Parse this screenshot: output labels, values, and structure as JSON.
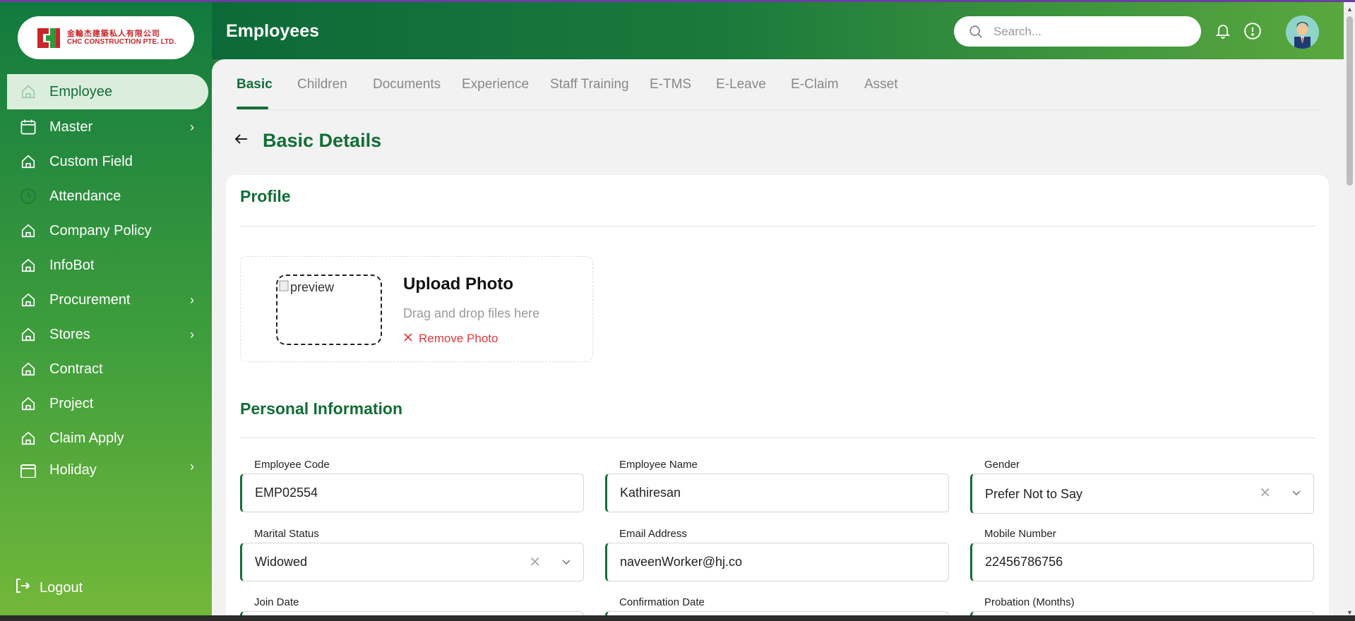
{
  "header": {
    "title": "Employees",
    "search_placeholder": "Search...",
    "icons": [
      "bell-icon",
      "alert-circle-icon",
      "user-avatar"
    ]
  },
  "logo": {
    "chinese": "金輪杰建築私人有限公司",
    "english": "CHC CONSTRUCTION PTE. LTD."
  },
  "sidebar": {
    "items": [
      {
        "label": "Employee",
        "icon": "home-icon",
        "active": true,
        "chevron": false
      },
      {
        "label": "Master",
        "icon": "calendar-icon",
        "active": false,
        "chevron": true
      },
      {
        "label": "Custom Field",
        "icon": "home-icon",
        "active": false,
        "chevron": false
      },
      {
        "label": "Attendance",
        "icon": "clock-icon",
        "active": false,
        "chevron": false
      },
      {
        "label": "Company Policy",
        "icon": "home-icon",
        "active": false,
        "chevron": false
      },
      {
        "label": "InfoBot",
        "icon": "home-icon",
        "active": false,
        "chevron": false
      },
      {
        "label": "Procurement",
        "icon": "home-icon",
        "active": false,
        "chevron": true
      },
      {
        "label": "Stores",
        "icon": "home-icon",
        "active": false,
        "chevron": true
      },
      {
        "label": "Contract",
        "icon": "home-icon",
        "active": false,
        "chevron": false
      },
      {
        "label": "Project",
        "icon": "home-icon",
        "active": false,
        "chevron": false
      },
      {
        "label": "Claim Apply",
        "icon": "home-icon",
        "active": false,
        "chevron": false
      },
      {
        "label": "Holiday",
        "icon": "calendar-icon",
        "active": false,
        "chevron": true
      }
    ],
    "logout_label": "Logout"
  },
  "tabs": [
    "Basic",
    "Children",
    "Documents",
    "Experience",
    "Staff Training",
    "E-TMS",
    "E-Leave",
    "E-Claim",
    "Asset"
  ],
  "active_tab": "Basic",
  "section_title": "Basic Details",
  "profile": {
    "heading": "Profile",
    "preview_alt": "preview",
    "upload_title": "Upload Photo",
    "upload_hint": "Drag and drop files here",
    "remove_label": "Remove Photo"
  },
  "personal": {
    "heading": "Personal Information",
    "fields": {
      "employee_code": {
        "label": "Employee Code",
        "value": "EMP02554"
      },
      "employee_name": {
        "label": "Employee Name",
        "value": "Kathiresan"
      },
      "gender": {
        "label": "Gender",
        "value": "Prefer Not to Say"
      },
      "marital_status": {
        "label": "Marital Status",
        "value": "Widowed"
      },
      "email": {
        "label": "Email Address",
        "value": "naveenWorker@hj.co"
      },
      "mobile": {
        "label": "Mobile Number",
        "value": "22456786756"
      },
      "join_date": {
        "label": "Join Date",
        "value": ""
      },
      "confirmation_date": {
        "label": "Confirmation Date",
        "value": ""
      },
      "probation": {
        "label": "Probation (Months)",
        "value": ""
      }
    }
  },
  "colors": {
    "brand_green": "#126e36",
    "danger": "#e0393e"
  }
}
